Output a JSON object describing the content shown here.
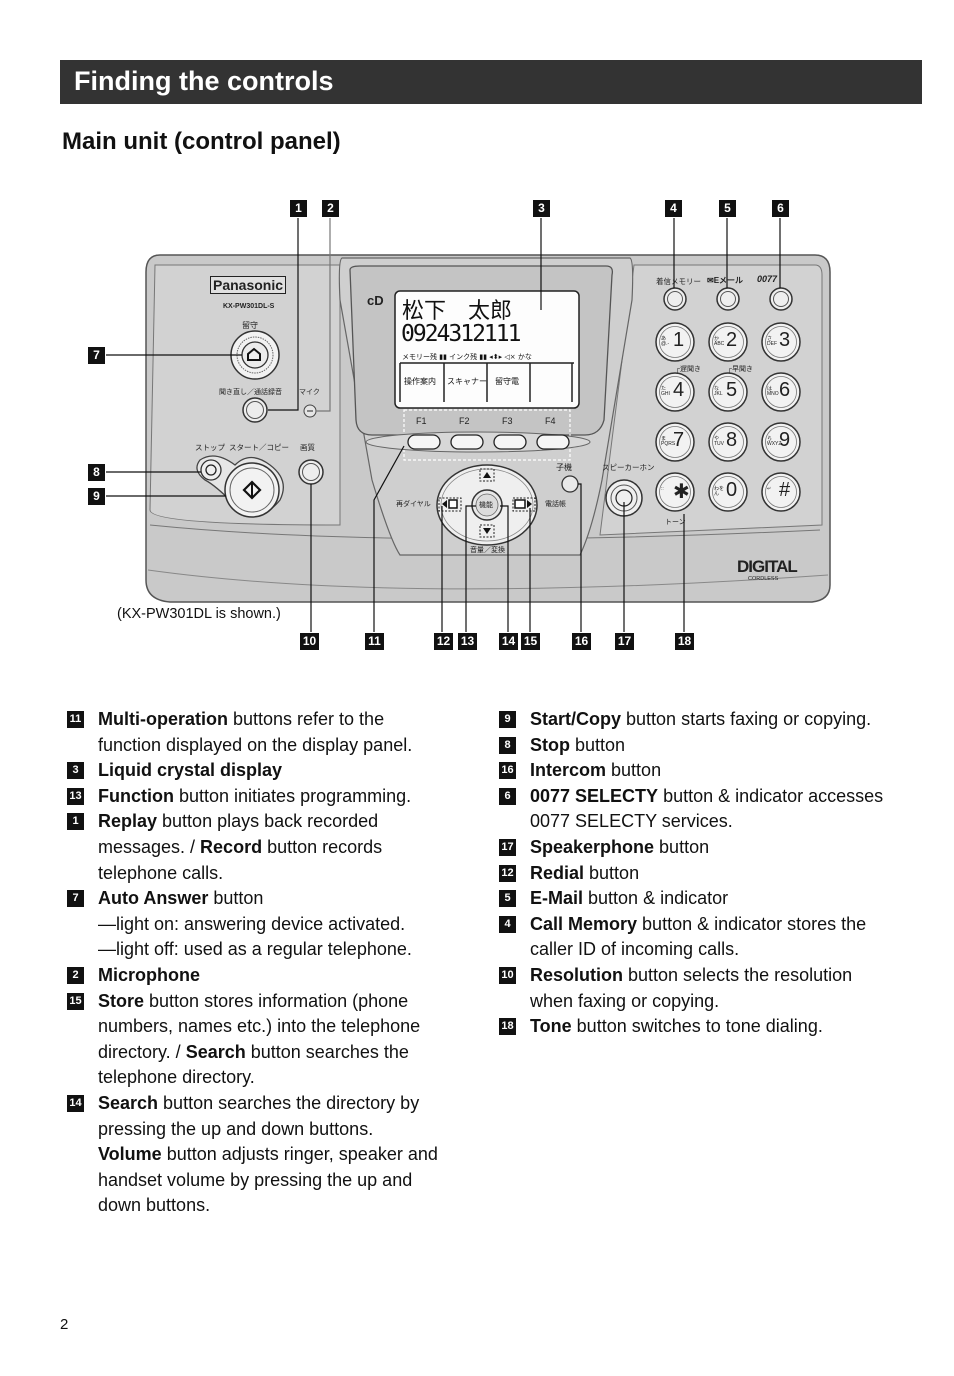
{
  "header": {
    "title": "Finding the controls"
  },
  "section": {
    "title": "Main unit (control panel)"
  },
  "diagram": {
    "caption": "(KX-PW301DL is shown.)",
    "brand": "Panasonic",
    "model": "KX-PW301DL-S",
    "lcd": {
      "line1": "松下　太郎",
      "line2": "0924312111",
      "status": "メモリー残 ▮▮ インク残 ▮▮ ◂⬍▸ ◁× かな",
      "softkeys": [
        "操作案内",
        "スキャナー",
        "留守電",
        ""
      ]
    },
    "fkeys": [
      "F1",
      "F2",
      "F3",
      "F4"
    ],
    "labels": {
      "auto_answer": "留守",
      "replay_record": "聞き直し／通話録音",
      "mic": "マイク",
      "stop": "ストップ",
      "start_copy": "スタート／コピー",
      "resolution": "画質",
      "redial": "再ダイヤル",
      "phonebook": "電話帳",
      "function": "機能",
      "volume": "音量／変換",
      "intercom": "子機",
      "speakerphone": "スピーカーホン",
      "call_memory": "着信メモリー",
      "email": "✉Eメール",
      "selecty": "0077",
      "tone": "トーン",
      "slow": "┌遅聞き",
      "fast": "┌早聞き",
      "digital": "DIGITAL",
      "cordless": "CORDLESS"
    },
    "keypad": [
      {
        "key": "1",
        "sub": "あ@.-"
      },
      {
        "key": "2",
        "sub": "かABC"
      },
      {
        "key": "3",
        "sub": "さDEF"
      },
      {
        "key": "4",
        "sub": "たGHI"
      },
      {
        "key": "5",
        "sub": "なJKL"
      },
      {
        "key": "6",
        "sub": "はMNO"
      },
      {
        "key": "7",
        "sub": "まPQRS"
      },
      {
        "key": "8",
        "sub": "やTUV"
      },
      {
        "key": "9",
        "sub": "らWXYZ"
      },
      {
        "key": "✱",
        "sub": "::"
      },
      {
        "key": "0",
        "sub": "わをん"
      },
      {
        "key": "#",
        "sub": "↵"
      }
    ],
    "callouts": [
      "1",
      "2",
      "3",
      "4",
      "5",
      "6",
      "7",
      "8",
      "9",
      "10",
      "11",
      "12",
      "13",
      "14",
      "15",
      "16",
      "17",
      "18"
    ]
  },
  "descriptions": {
    "left": [
      {
        "num": "11",
        "bold": "Multi-operation",
        "text": " buttons refer to the function displayed on the display panel."
      },
      {
        "num": "3",
        "bold": "Liquid crystal display",
        "text": ""
      },
      {
        "num": "13",
        "bold": "Function",
        "text": " button initiates programming."
      },
      {
        "num": "1",
        "bold": "Replay",
        "text": " button plays back recorded messages. / ",
        "bold2": "Record",
        "text2": " button records telephone calls."
      },
      {
        "num": "7",
        "bold": "Auto Answer",
        "text": " button",
        "lines": [
          "—light on:  answering device activated.",
          "—light off:  used as a regular telephone."
        ]
      },
      {
        "num": "2",
        "bold": "Microphone",
        "text": ""
      },
      {
        "num": "15",
        "bold": "Store",
        "text": " button stores information (phone numbers, names etc.) into the telephone directory. / ",
        "bold2": "Search",
        "text2": " button searches the telephone directory."
      },
      {
        "num": "14",
        "bold": "Search",
        "text": " button searches the directory by pressing the up and down buttons.",
        "bold2": "Volume",
        "text2": " button adjusts ringer, speaker and handset volume by pressing the up and down buttons.",
        "break2": true
      }
    ],
    "right": [
      {
        "num": "9",
        "bold": "Start/Copy",
        "text": " button starts faxing or copying."
      },
      {
        "num": "8",
        "bold": "Stop",
        "text": " button"
      },
      {
        "num": "16",
        "bold": "Intercom",
        "text": " button"
      },
      {
        "num": "6",
        "bold": "0077 SELECTY",
        "text": " button & indicator accesses 0077 SELECTY services."
      },
      {
        "num": "17",
        "bold": "Speakerphone",
        "text": " button"
      },
      {
        "num": "12",
        "bold": "Redial",
        "text": " button"
      },
      {
        "num": "5",
        "bold": "E-Mail",
        "text": " button & indicator"
      },
      {
        "num": "4",
        "bold": "Call Memory",
        "text": " button & indicator stores the caller ID of incoming calls."
      },
      {
        "num": "10",
        "bold": "Resolution",
        "text": " button selects the resolution when faxing or copying."
      },
      {
        "num": "18",
        "bold": "Tone",
        "text": " button switches to tone dialing."
      }
    ]
  },
  "page": {
    "number": "2"
  }
}
